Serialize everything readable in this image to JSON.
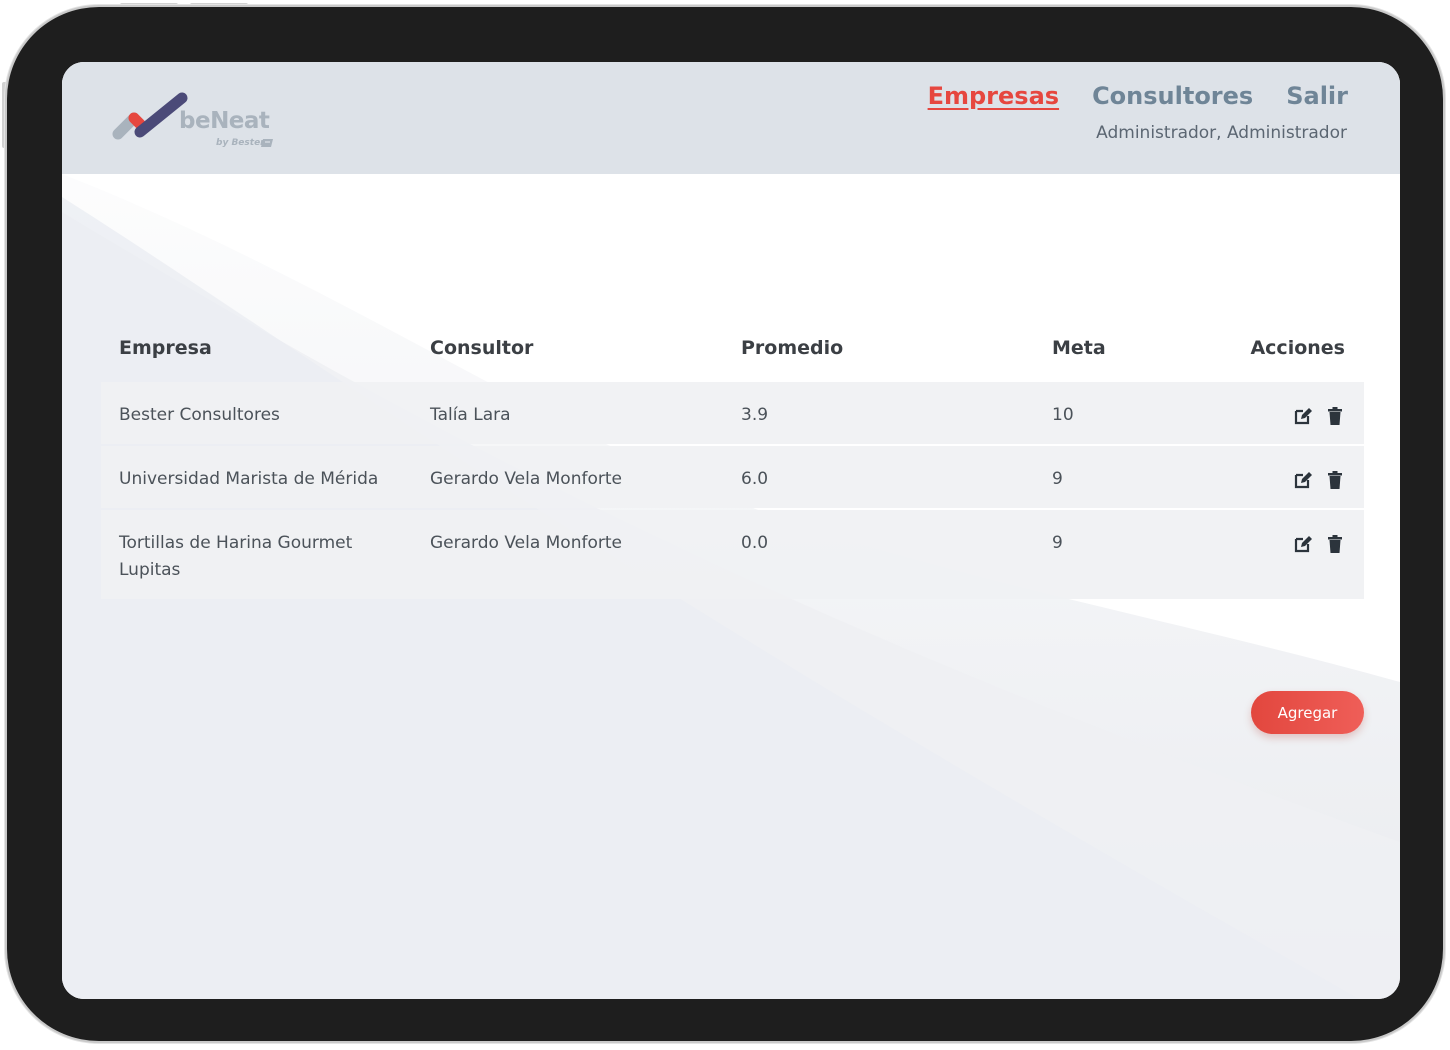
{
  "brand": {
    "name": "beNeat",
    "byline": "by Bester",
    "colors": {
      "accent": "#e6473f",
      "nav": "#6f8597",
      "logo_dark": "#4b4a78",
      "logo_red": "#e6473f",
      "logo_gray": "#a9b3bd"
    }
  },
  "nav": {
    "empresas": "Empresas",
    "consultores": "Consultores",
    "salir": "Salir",
    "active": "empresas"
  },
  "user": {
    "name": "Administrador, Administrador"
  },
  "table": {
    "columns": [
      "Empresa",
      "Consultor",
      "Promedio",
      "Meta",
      "Acciones"
    ],
    "rows": [
      {
        "empresa": "Bester Consultores",
        "consultor": "Talía Lara",
        "promedio": "3.9",
        "meta": "10"
      },
      {
        "empresa": "Universidad Marista de Mérida",
        "consultor": "Gerardo Vela Monforte",
        "promedio": "6.0",
        "meta": "9"
      },
      {
        "empresa": "Tortillas de Harina Gourmet Lupitas",
        "consultor": "Gerardo Vela Monforte",
        "promedio": "0.0",
        "meta": "9"
      }
    ],
    "row_action_icons": [
      "edit-icon",
      "trash-icon"
    ]
  },
  "add_button": {
    "label": "Agregar"
  }
}
